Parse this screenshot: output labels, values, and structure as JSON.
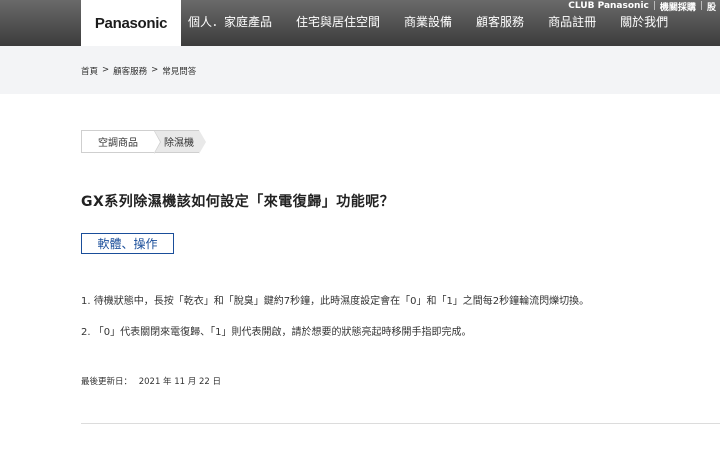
{
  "header": {
    "logo": "Panasonic",
    "utility_links": [
      "CLUB Panasonic",
      "機關採購",
      "股"
    ],
    "nav": [
      "個人．家庭產品",
      "住宅與居住空間",
      "商業設備",
      "顧客服務",
      "商品註冊",
      "關於我們"
    ]
  },
  "breadcrumb": [
    "首頁",
    "顧客服務",
    "常見問答"
  ],
  "breadcrumb_separator": ">",
  "categories": [
    "空調商品",
    "除濕機"
  ],
  "question": "GX系列除濕機該如何設定「來電復歸」功能呢？",
  "tag": "軟體、操作",
  "answer": [
    "1. 待機狀態中，長按「乾衣」和「脫臭」鍵約7秒鐘，此時濕度設定會在「0」和「1」之間每2秒鐘輪流閃爍切換。",
    "2. 「0」代表關閉來電復歸、「1」則代表開啟，請於想要的狀態亮起時移開手指即完成。"
  ],
  "updated": {
    "label": "最後更新日：",
    "date": "2021 年 11 月 22 日"
  }
}
